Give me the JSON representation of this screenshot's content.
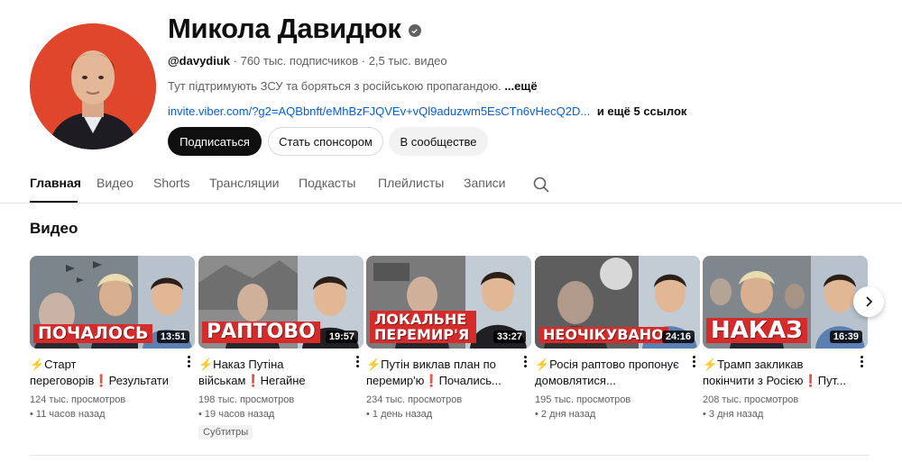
{
  "channel": {
    "name": "Микола Давидюк",
    "handle": "@davydiuk",
    "subscribers": " · 760 тыс. подписчиков",
    "videos": " · 2,5 тыс. видео",
    "description": "Тут підтримують ЗСУ та боряться з російською пропагандою.",
    "description_more": "...ещё",
    "link": "invite.viber.com/?g2=AQBbnft/eMhBzFJQVEv+vQl9aduzwm5EsCTn6vHecQ2D...",
    "more_links": "и ещё 5 ссылок"
  },
  "buttons": {
    "subscribe": "Подписаться",
    "sponsor": "Стать спонсором",
    "community": "В сообществе"
  },
  "tabs": [
    {
      "label": "Главная",
      "active": true
    },
    {
      "label": "Видео"
    },
    {
      "label": "Shorts"
    },
    {
      "label": "Трансляции"
    },
    {
      "label": "Подкасты"
    },
    {
      "label": "Плейлисты"
    },
    {
      "label": "Записи"
    }
  ],
  "section": {
    "title": "Видео"
  },
  "videos": [
    {
      "thumb_text": "ПОЧАЛОСЬ",
      "duration": "13:51",
      "title": "⚡️Старт переговорів❗️Результати розмови...",
      "views": "124 тыс. просмотров",
      "time": "11 часов назад"
    },
    {
      "thumb_text": "РАПТОВО",
      "duration": "19:57",
      "title": "⚡️Наказ Путіна військам❗️Негайне звернення СШ...",
      "views": "198 тыс. просмотров",
      "time": "19 часов назад",
      "badge": "Субтитры"
    },
    {
      "thumb_text": "ЛОКАЛЬНЕ ПЕРЕМИР'Я",
      "duration": "33:27",
      "title": "⚡️Путін виклав план по перемир'ю❗️Почались...",
      "views": "234 тыс. просмотров",
      "time": "1 день назад"
    },
    {
      "thumb_text": "НЕОЧІКУВАНО",
      "duration": "24:16",
      "title": "⚡️Росія раптово пропонує домовлятися...",
      "views": "195 тыс. просмотров",
      "time": "2 дня назад"
    },
    {
      "thumb_text": "НАКАЗ",
      "duration": "16:39",
      "title": "⚡️Трамп закликав покінчити з Росією❗️Пут...",
      "views": "208 тыс. просмотров",
      "time": "3 дня назад"
    }
  ],
  "colors": {
    "banner_red": "#d62b2b",
    "avatar_bg": "#e0462c",
    "link_blue": "#065fd4"
  }
}
